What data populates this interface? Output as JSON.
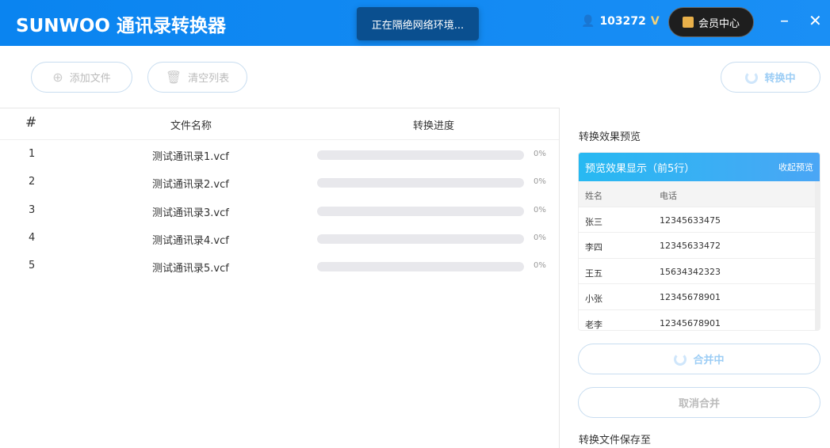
{
  "header": {
    "logo": "SUNWOO 通讯录转换器",
    "toast": "正在隔绝网络环境...",
    "user_id": "103272",
    "vip_label": "会员中心",
    "minimize": "–",
    "close": "✕"
  },
  "toolbar": {
    "add_file": "添加文件",
    "clear_list": "清空列表",
    "convert": "转换中"
  },
  "table": {
    "headers": [
      "#",
      "文件名称",
      "转换进度"
    ],
    "rows": [
      {
        "n": "1",
        "file": "测试通讯录1.vcf",
        "progress": 0,
        "pct": "0%"
      },
      {
        "n": "2",
        "file": "测试通讯录2.vcf",
        "progress": 0,
        "pct": "0%"
      },
      {
        "n": "3",
        "file": "测试通讯录3.vcf",
        "progress": 0,
        "pct": "0%"
      },
      {
        "n": "4",
        "file": "测试通讯录4.vcf",
        "progress": 0,
        "pct": "0%"
      },
      {
        "n": "5",
        "file": "测试通讯录5.vcf",
        "progress": 0,
        "pct": "0%"
      }
    ]
  },
  "preview": {
    "title": "转换效果预览",
    "header": "预览效果显示（前5行）",
    "collapse": "收起预览",
    "cols": [
      "姓名",
      "电话"
    ],
    "rows": [
      [
        "张三",
        "12345633475"
      ],
      [
        "李四",
        "12345633472"
      ],
      [
        "王五",
        "15634342323"
      ],
      [
        "小张",
        "12345678901"
      ],
      [
        "老李",
        "12345678901"
      ]
    ]
  },
  "actions": {
    "merging": "合并中",
    "cancel_merge": "取消合并",
    "save_to": "转换文件保存至"
  }
}
